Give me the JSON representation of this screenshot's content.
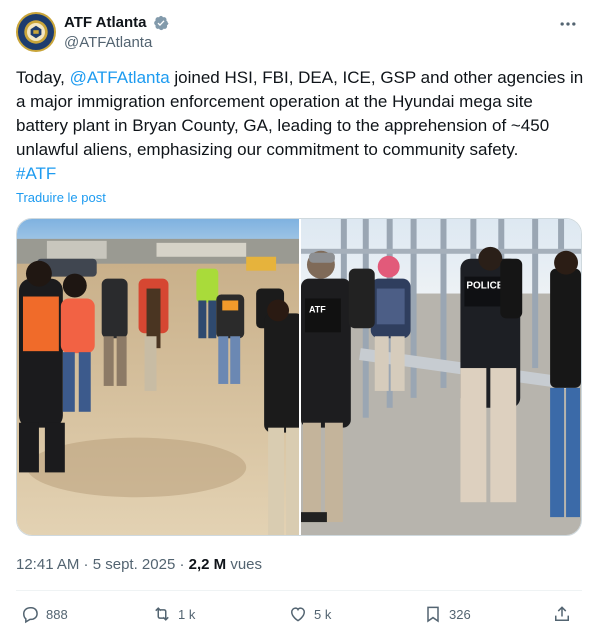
{
  "author": {
    "display_name": "ATF Atlanta",
    "handle": "@ATFAtlanta",
    "verified_icon": "verified-badge-icon",
    "verified_color": "#829aab"
  },
  "tweet": {
    "text_before": "Today, ",
    "mention": "@ATFAtlanta",
    "text_after": " joined HSI, FBI, DEA, ICE, GSP and other agencies in a major immigration enforcement operation at the Hyundai mega site battery plant in Bryan County, GA, leading to the apprehension of ~450 unlawful aliens, emphasizing our commitment to community safety.",
    "hashtag": "#ATF",
    "translate_label": "Traduire le post"
  },
  "media": {
    "left_vest_text": "",
    "right_vest_texts": [
      "ATF",
      "POLICE"
    ]
  },
  "meta": {
    "time": "12:41 AM",
    "separator": " · ",
    "date": "5 sept. 2025",
    "separator2": " · ",
    "views_count": "2,2 M",
    "views_label": " vues"
  },
  "actions": {
    "replies": "888",
    "reposts": "1 k",
    "likes": "5 k",
    "bookmarks": "326"
  },
  "colors": {
    "accent": "#1d9bf0",
    "text": "#0f1419",
    "secondary": "#536471"
  }
}
